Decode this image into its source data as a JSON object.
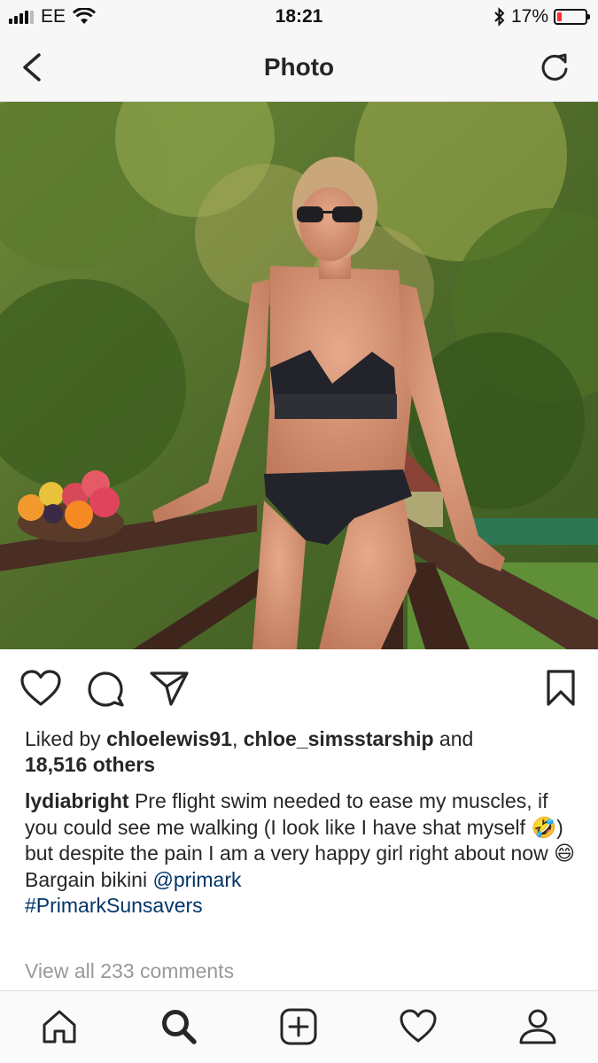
{
  "status_bar": {
    "carrier": "EE",
    "time": "18:21",
    "battery_percent": "17%",
    "battery_level": 0.17,
    "battery_color": "#ff2d2d",
    "icons": [
      "signal-icon",
      "wifi-icon",
      "bluetooth-icon",
      "battery-icon"
    ]
  },
  "nav": {
    "title": "Photo",
    "back_icon": "chevron-left-icon",
    "refresh_icon": "refresh-icon"
  },
  "post": {
    "image_description_icon": "photo",
    "actions": [
      "heart-icon",
      "comment-icon",
      "share-icon",
      "bookmark-icon"
    ],
    "likes_prefix": "Liked by ",
    "liked_by_1": "chloelewis91",
    "liked_sep": ", ",
    "liked_by_2": "chloe_simsstarship",
    "likes_and": " and",
    "likes_others": "18,516 others",
    "caption_user": "lydiabright",
    "caption_text_1": " Pre flight swim needed to ease my muscles, if you could see me walking (I look like I have shat myself ",
    "emoji_1": "🤣",
    "caption_text_2": ") but despite the pain I am a very happy girl right about now ",
    "emoji_2": "😄",
    "caption_line_2": "Bargain bikini ",
    "mention": "@primark",
    "hashtag": "#PrimarkSunsavers",
    "view_comments": "View all 233 comments",
    "link_color": "#003569"
  },
  "tab_bar": {
    "tabs": [
      "home-icon",
      "search-icon",
      "add-post-icon",
      "activity-heart-icon",
      "profile-icon"
    ]
  }
}
